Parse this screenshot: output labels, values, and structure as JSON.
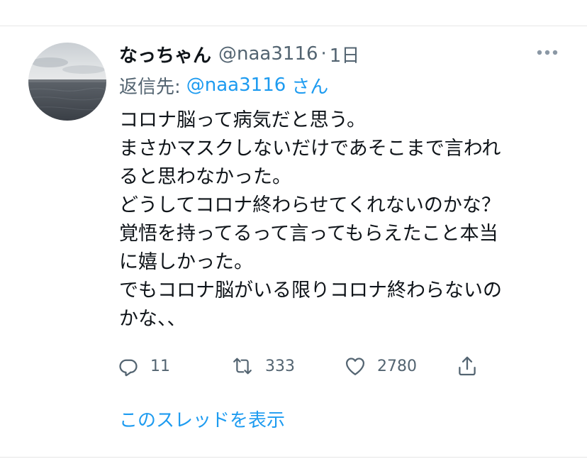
{
  "tweet": {
    "display_name": "なっちゃん",
    "handle": "@naa3116",
    "separator": "·",
    "time": "1日",
    "reply": {
      "prefix": "返信先:",
      "handle": "@naa3116",
      "suffix": "さん"
    },
    "text_lines": [
      "コロナ脳って病気だと思う。",
      "まさかマスクしないだけであそこまで言われ",
      "ると思わなかった。",
      "どうしてコロナ終わらせてくれないのかな？",
      "覚悟を持ってるって言ってもらえたこと本当",
      "に嬉しかった。",
      "でもコロナ脳がいる限りコロナ終わらないの",
      "かな、、"
    ],
    "actions": {
      "reply_count": "11",
      "retweet_count": "333",
      "like_count": "2780"
    },
    "show_thread": "このスレッドを表示"
  },
  "icons": {
    "more": "more-horizontal-icon",
    "reply": "reply-bubble-icon",
    "retweet": "retweet-icon",
    "like": "heart-icon",
    "share": "share-icon"
  },
  "colors": {
    "text": "#0f1419",
    "secondary": "#536471",
    "link": "#1d9bf0",
    "divider": "#e6e6e6"
  }
}
